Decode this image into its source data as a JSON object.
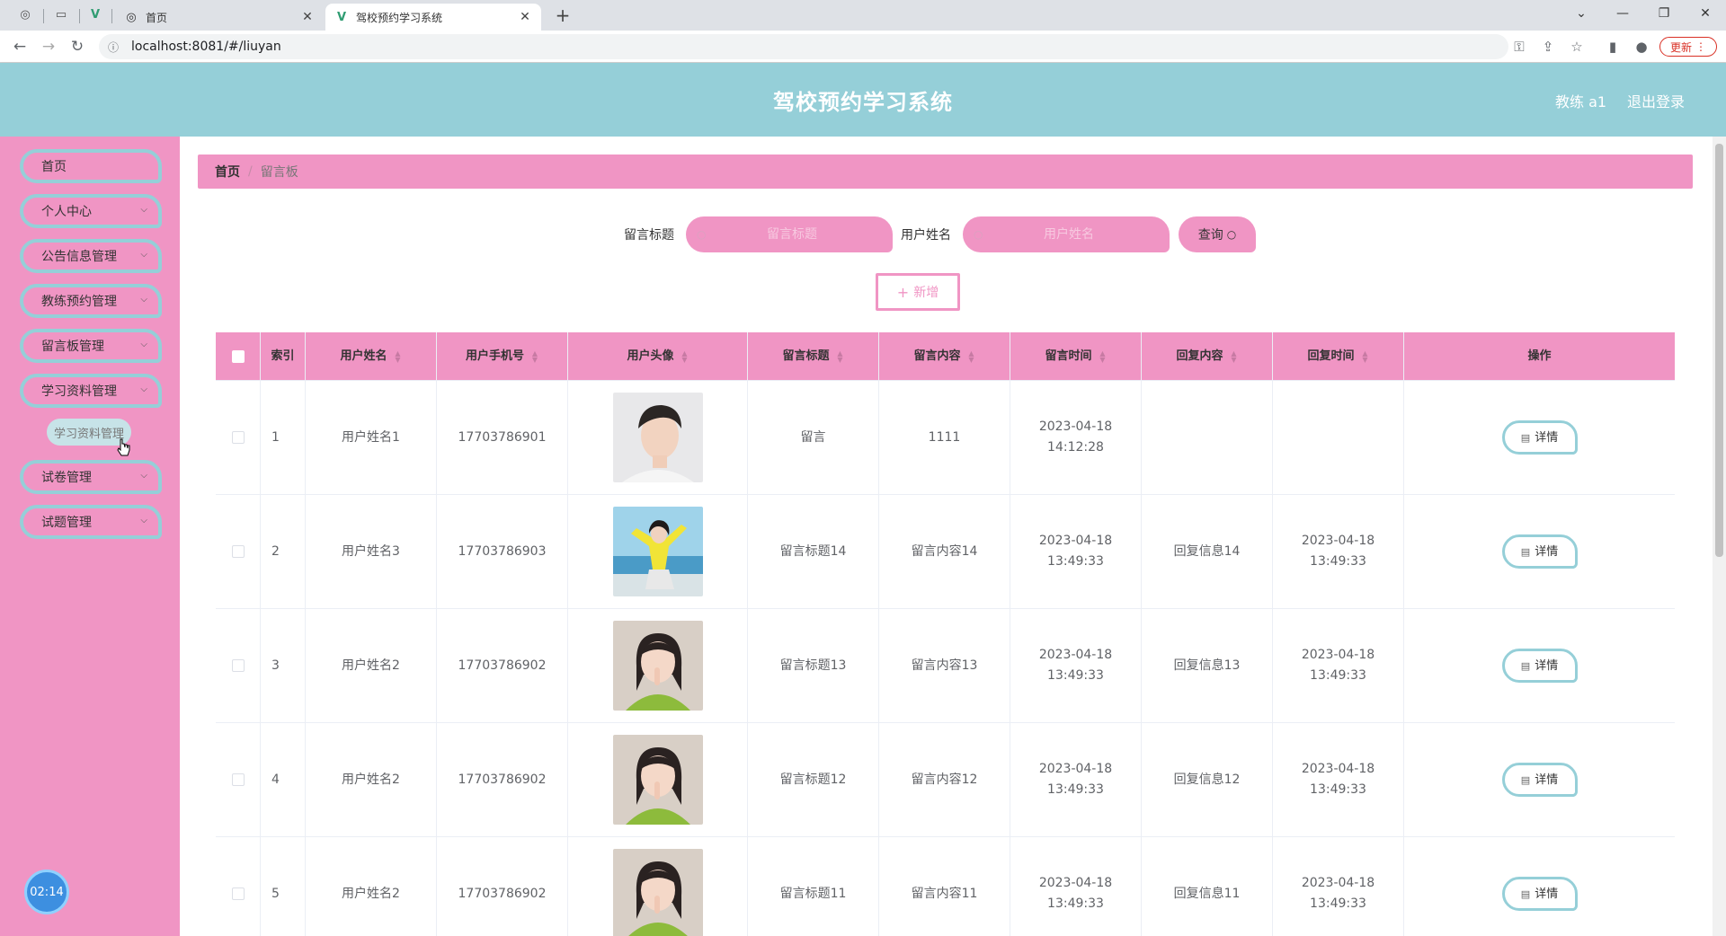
{
  "browser": {
    "tabs": [
      {
        "title": "首页",
        "active": false
      },
      {
        "title": "驾校预约学习系统",
        "active": true
      }
    ],
    "url": "localhost:8081/#/liuyan",
    "update_label": "更新"
  },
  "header": {
    "title": "驾校预约学习系统",
    "user": "教练 a1",
    "logout": "退出登录"
  },
  "sidebar": {
    "items": [
      {
        "label": "首页",
        "has_children": false
      },
      {
        "label": "个人中心",
        "has_children": true
      },
      {
        "label": "公告信息管理",
        "has_children": true
      },
      {
        "label": "教练预约管理",
        "has_children": true
      },
      {
        "label": "留言板管理",
        "has_children": true
      },
      {
        "label": "学习资料管理",
        "has_children": true
      },
      {
        "label": "试卷管理",
        "has_children": true
      },
      {
        "label": "试题管理",
        "has_children": true
      }
    ],
    "submenu_item": "学习资料管理",
    "timer": "02:14"
  },
  "breadcrumb": {
    "home": "首页",
    "separator": "/",
    "current": "留言板"
  },
  "search": {
    "title_label": "留言标题",
    "title_placeholder": "留言标题",
    "name_label": "用户姓名",
    "name_placeholder": "用户姓名",
    "query_label": "查询"
  },
  "add_label": "新增",
  "table": {
    "columns": [
      "索引",
      "用户姓名",
      "用户手机号",
      "用户头像",
      "留言标题",
      "留言内容",
      "留言时间",
      "回复内容",
      "回复时间",
      "操作"
    ],
    "rows": [
      {
        "index": "1",
        "name": "用户姓名1",
        "phone": "17703786901",
        "avatar": "male-white",
        "title": "留言",
        "content": "1111",
        "time": "2023-04-18 14:12:28",
        "reply": "",
        "reply_time": ""
      },
      {
        "index": "2",
        "name": "用户姓名3",
        "phone": "17703786903",
        "avatar": "female-yellow-beach",
        "title": "留言标题14",
        "content": "留言内容14",
        "time": "2023-04-18 13:49:33",
        "reply": "回复信息14",
        "reply_time": "2023-04-18 13:49:33"
      },
      {
        "index": "3",
        "name": "用户姓名2",
        "phone": "17703786902",
        "avatar": "female-green",
        "title": "留言标题13",
        "content": "留言内容13",
        "time": "2023-04-18 13:49:33",
        "reply": "回复信息13",
        "reply_time": "2023-04-18 13:49:33"
      },
      {
        "index": "4",
        "name": "用户姓名2",
        "phone": "17703786902",
        "avatar": "female-green",
        "title": "留言标题12",
        "content": "留言内容12",
        "time": "2023-04-18 13:49:33",
        "reply": "回复信息12",
        "reply_time": "2023-04-18 13:49:33"
      },
      {
        "index": "5",
        "name": "用户姓名2",
        "phone": "17703786902",
        "avatar": "female-green",
        "title": "留言标题11",
        "content": "留言内容11",
        "time": "2023-04-18 13:49:33",
        "reply": "回复信息11",
        "reply_time": "2023-04-18 13:49:33"
      }
    ],
    "detail_label": "详情"
  },
  "colors": {
    "header_bg": "#95cfd8",
    "pink": "#f095c4",
    "teal_border": "#95cfd8"
  }
}
